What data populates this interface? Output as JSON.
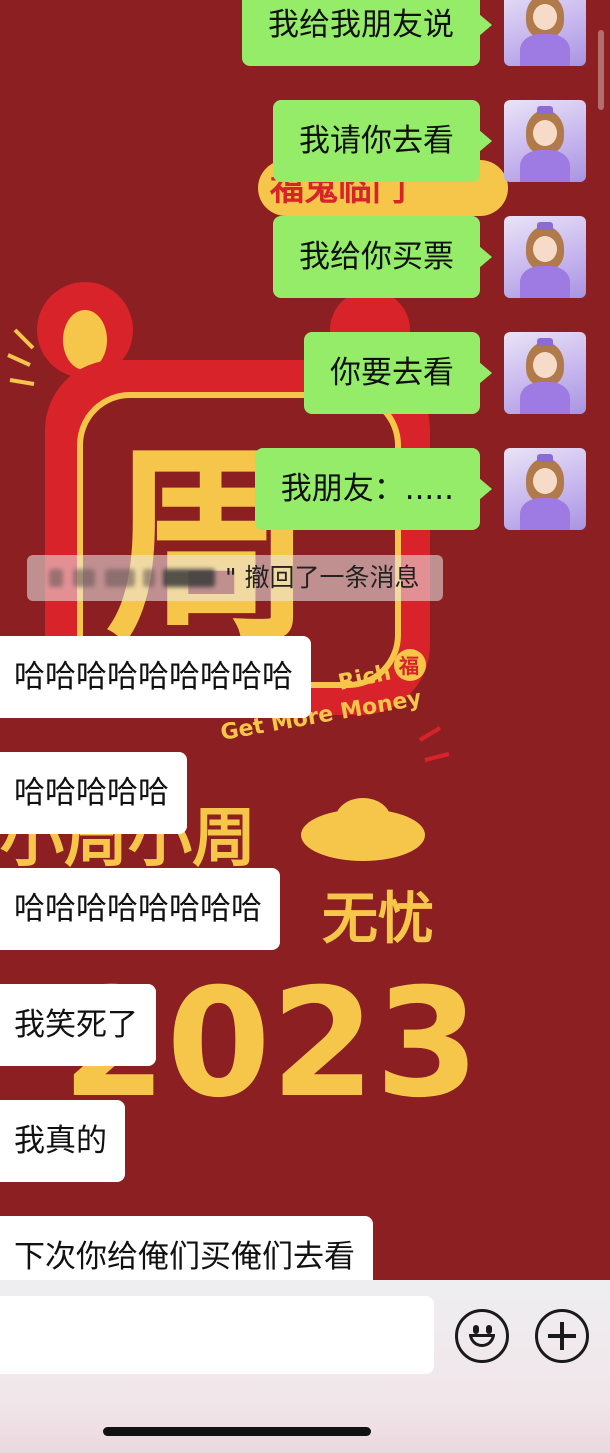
{
  "wallpaper": {
    "big_char": "周",
    "banner_text": "福鬼临门",
    "english_line1": "Rich",
    "english_line2": "Get More Money",
    "fu_char": "福",
    "line_text": "小周小周",
    "wish_text": "无忧",
    "year": "2023",
    "colors": {
      "background": "#8c1f22",
      "gold": "#f6c64b",
      "red": "#d8232a"
    }
  },
  "messages_outgoing": [
    {
      "text": "我给我朋友说"
    },
    {
      "text": "我请你去看"
    },
    {
      "text": "我给你买票"
    },
    {
      "text": "你要去看"
    },
    {
      "text": "我朋友：....."
    }
  ],
  "recall_notice": {
    "text": "\" 撤回了一条消息"
  },
  "messages_incoming": [
    {
      "text": "哈哈哈哈哈哈哈哈哈"
    },
    {
      "text": "哈哈哈哈哈"
    },
    {
      "text": "哈哈哈哈哈哈哈哈"
    },
    {
      "text": "我笑死了"
    },
    {
      "text": "我真的"
    },
    {
      "text": "下次你给俺们买俺们去看"
    }
  ],
  "input_bar": {
    "input_value": "",
    "emoji_icon": "smiley-face-icon",
    "plus_icon": "plus-circle-icon"
  },
  "colors": {
    "bubble_outgoing": "#95ec69",
    "bubble_incoming": "#ffffff"
  }
}
